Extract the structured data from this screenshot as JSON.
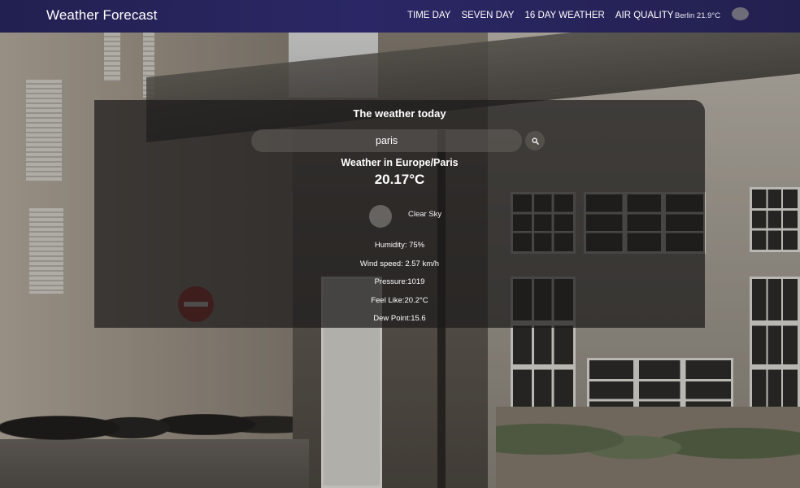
{
  "navbar": {
    "brand": "Weather Forecast",
    "links": [
      "TIME DAY",
      "SEVEN DAY",
      "16 DAY WEATHER",
      "AIR QUALITY"
    ],
    "city_temp": "Berlin 21.9°C",
    "toggle_icon": "theme-toggle-icon",
    "background_color": "#2b2766"
  },
  "card": {
    "title": "The weather today",
    "search": {
      "value": "paris",
      "placeholder": ""
    },
    "search_icon": "search-icon",
    "location": "Weather in Europe/Paris",
    "temperature": "20.17°C",
    "condition_icon": "weather-condition-icon",
    "condition": "Clear Sky",
    "details": {
      "humidity": "Humidity: 75%",
      "wind_speed": "Wind speed: 2.57 km/h",
      "pressure": "Pressure:1019",
      "feels_like": "Feel Like:20.2°C",
      "dew_point": "Dew Point:15.6"
    }
  }
}
